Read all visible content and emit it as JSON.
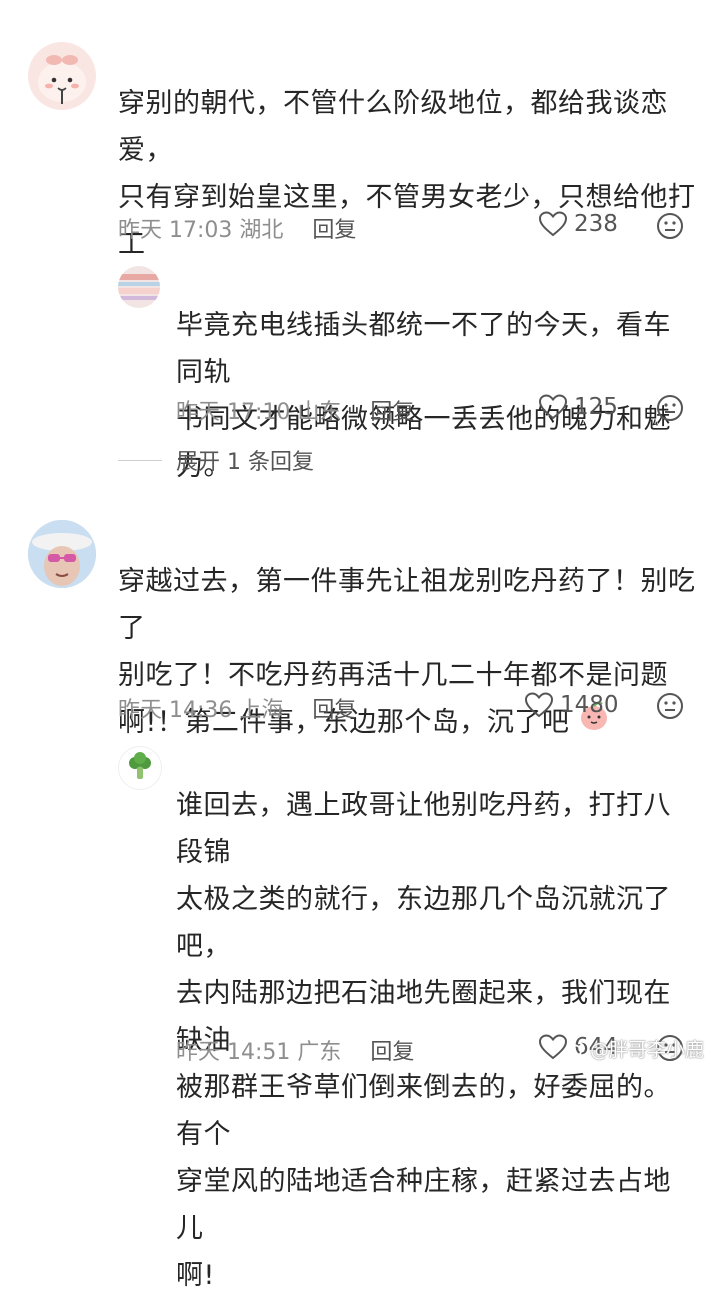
{
  "comments": [
    {
      "text_lines": [
        "穿别的朝代，不管什么阶级地位，都给我谈恋爱，",
        "只有穿到始皇这里，不管男女老少，只想给他打工"
      ],
      "time": "昨天 17:03",
      "location": "湖北",
      "reply_label": "回复",
      "likes": "238"
    },
    {
      "text_lines": [
        "毕竟充电线插头都统一不了的今天，看车同轨",
        "书同文才能略微领略一丢丢他的魄力和魅力。"
      ],
      "time": "昨天 17:10",
      "location": "山东",
      "reply_label": "回复",
      "likes": "125"
    },
    {
      "text_lines": [
        "穿越过去，第一件事先让祖龙别吃丹药了！别吃了",
        "别吃了！不吃丹药再活十几二十年都不是问题",
        "啊!！第二件事，东边那个岛，沉了吧"
      ],
      "time": "昨天 14:36",
      "location": "上海",
      "reply_label": "回复",
      "likes": "1480"
    },
    {
      "text_lines": [
        "谁回去，遇上政哥让他别吃丹药，打打八段锦",
        "太极之类的就行，东边那几个岛沉就沉了吧，",
        "去内陆那边把石油地先圈起来，我们现在缺油",
        "被那群王爷草们倒来倒去的，好委屈的。有个",
        "穿堂风的陆地适合种庄稼，赶紧过去占地儿",
        "啊!"
      ],
      "time": "昨天 14:51",
      "location": "广东",
      "reply_label": "回复",
      "likes": "644"
    }
  ],
  "expand_replies": "展开 1 条回复",
  "watermark": "@胖哥李小鹿",
  "colors": {
    "text": "#262626",
    "meta": "#8e8e8e",
    "icon": "#555555"
  }
}
